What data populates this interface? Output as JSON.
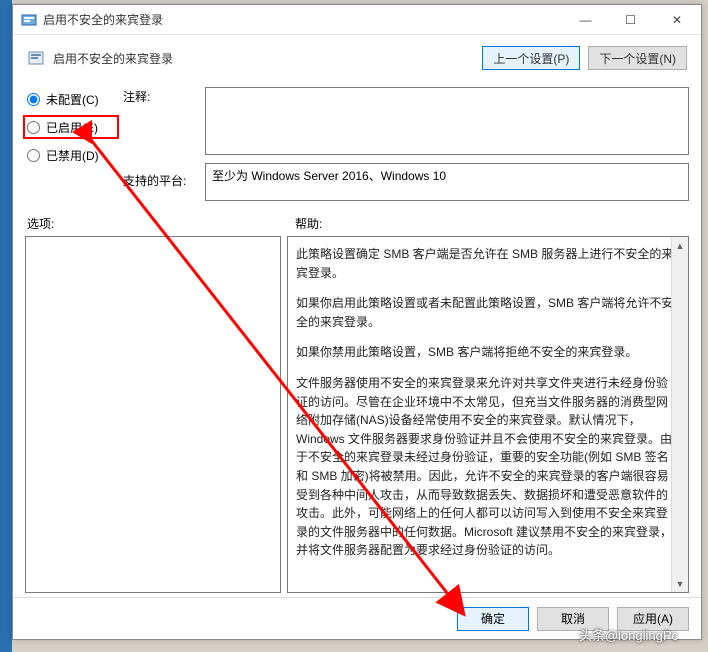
{
  "titlebar": {
    "title": "启用不安全的来宾登录"
  },
  "win_controls": {
    "min": "—",
    "max": "☐",
    "close": "✕"
  },
  "header": {
    "title": "启用不安全的来宾登录",
    "prev_btn": "上一个设置(P)",
    "next_btn": "下一个设置(N)"
  },
  "radios": {
    "not_configured": "未配置(C)",
    "enabled": "已启用(E)",
    "disabled": "已禁用(D)",
    "selected": "not_configured"
  },
  "labels": {
    "comment": "注释:",
    "platform": "支持的平台:",
    "options": "选项:",
    "help": "帮助:"
  },
  "fields": {
    "comment_value": "",
    "platform_value": "至少为 Windows Server 2016、Windows 10"
  },
  "help_paragraphs": [
    "此策略设置确定 SMB 客户端是否允许在 SMB 服务器上进行不安全的来宾登录。",
    "如果你启用此策略设置或者未配置此策略设置，SMB 客户端将允许不安全的来宾登录。",
    "如果你禁用此策略设置，SMB 客户端将拒绝不安全的来宾登录。",
    "文件服务器使用不安全的来宾登录来允许对共享文件夹进行未经身份验证的访问。尽管在企业环境中不太常见，但充当文件服务器的消费型网络附加存储(NAS)设备经常使用不安全的来宾登录。默认情况下，Windows 文件服务器要求身份验证并且不会使用不安全的来宾登录。由于不安全的来宾登录未经过身份验证，重要的安全功能(例如 SMB 签名和 SMB 加密)将被禁用。因此，允许不安全的来宾登录的客户端很容易受到各种中间人攻击，从而导致数据丢失、数据损坏和遭受恶意软件的攻击。此外，可能网络上的任何人都可以访问写入到使用不安全来宾登录的文件服务器中的任何数据。Microsoft 建议禁用不安全的来宾登录，并将文件服务器配置为要求经过身份验证的访问。"
  ],
  "footer": {
    "ok": "确定",
    "cancel": "取消",
    "apply": "应用(A)"
  },
  "watermark": "头条@longlingPc"
}
